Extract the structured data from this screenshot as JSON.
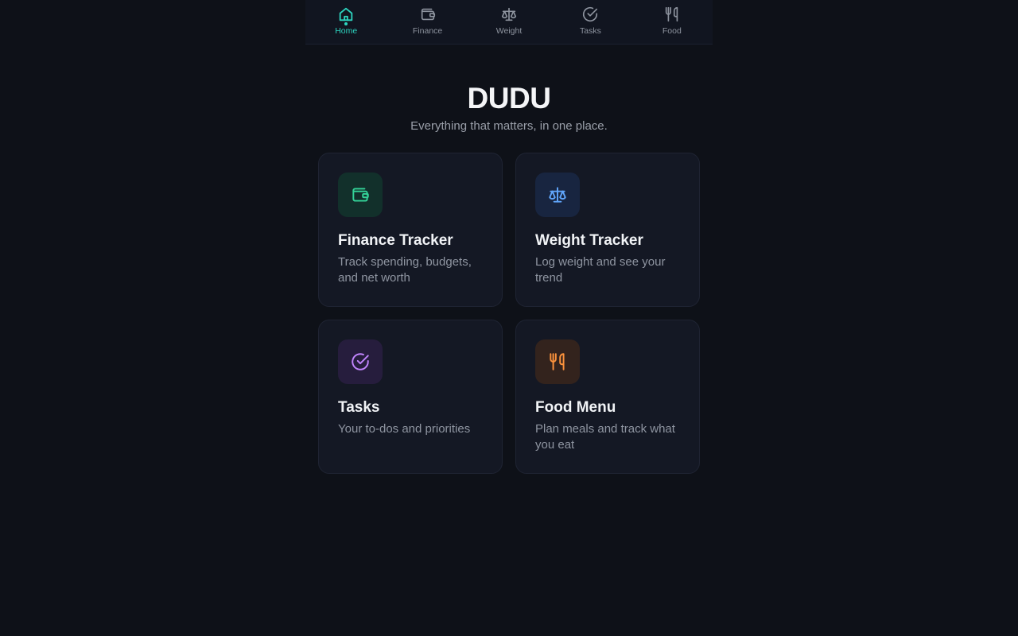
{
  "nav": {
    "items": [
      {
        "label": "Home",
        "icon": "home-icon",
        "active": true
      },
      {
        "label": "Finance",
        "icon": "wallet-icon",
        "active": false
      },
      {
        "label": "Weight",
        "icon": "scale-icon",
        "active": false
      },
      {
        "label": "Tasks",
        "icon": "check-circle-icon",
        "active": false
      },
      {
        "label": "Food",
        "icon": "utensils-icon",
        "active": false
      }
    ],
    "active_color": "#2dd4bf",
    "inactive_color": "#8e949f"
  },
  "hero": {
    "title": "DUDU",
    "subtitle": "Everything that matters, in one place."
  },
  "cards": [
    {
      "title": "Finance Tracker",
      "description": "Track spending, budgets, and net worth",
      "icon": "wallet-icon",
      "accent": "#34d399",
      "icon_bg": "#12302b"
    },
    {
      "title": "Weight Tracker",
      "description": "Log weight and see your trend",
      "icon": "scale-icon",
      "accent": "#60a5fa",
      "icon_bg": "#182540"
    },
    {
      "title": "Tasks",
      "description": "Your to-dos and priorities",
      "icon": "check-circle-icon",
      "accent": "#c084fc",
      "icon_bg": "#261d3d"
    },
    {
      "title": "Food Menu",
      "description": "Plan meals and track what you eat",
      "icon": "utensils-icon",
      "accent": "#fb923c",
      "icon_bg": "#33231d"
    }
  ]
}
